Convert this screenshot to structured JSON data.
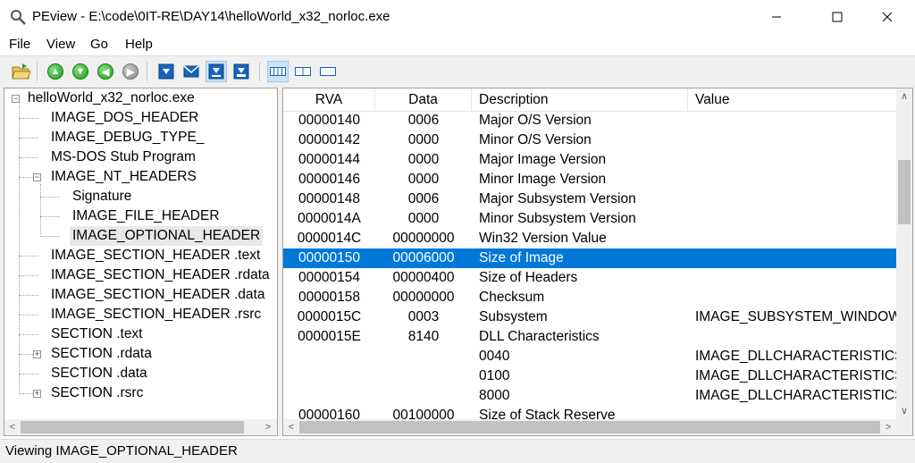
{
  "window": {
    "title": "PEview - E:\\code\\0IT-RE\\DAY14\\helloWorld_x32_norloc.exe",
    "minimize_glyph": "—",
    "maximize_glyph": "☐",
    "close_glyph": "✕"
  },
  "menu": [
    "File",
    "View",
    "Go",
    "Help"
  ],
  "toolbar": {
    "icons": [
      "open-folder-icon",
      "up-icon",
      "down-icon",
      "back-icon",
      "forward-icon",
      "save-icon",
      "mail-icon",
      "save-selected-icon",
      "export-icon",
      "view-byte-icon",
      "view-word-icon",
      "view-dword-icon"
    ]
  },
  "tree": {
    "items": [
      {
        "label": "helloWorld_x32_norloc.exe",
        "expander": "−"
      },
      {
        "label": "IMAGE_DOS_HEADER"
      },
      {
        "label": "IMAGE_DEBUG_TYPE_"
      },
      {
        "label": "MS-DOS Stub Program"
      },
      {
        "label": "IMAGE_NT_HEADERS",
        "expander": "−"
      },
      {
        "label": "Signature"
      },
      {
        "label": "IMAGE_FILE_HEADER"
      },
      {
        "label": "IMAGE_OPTIONAL_HEADER",
        "selected": true
      },
      {
        "label": "IMAGE_SECTION_HEADER .text"
      },
      {
        "label": "IMAGE_SECTION_HEADER .rdata"
      },
      {
        "label": "IMAGE_SECTION_HEADER .data"
      },
      {
        "label": "IMAGE_SECTION_HEADER .rsrc"
      },
      {
        "label": "SECTION .text"
      },
      {
        "label": "SECTION .rdata",
        "expander": "+"
      },
      {
        "label": "SECTION .data"
      },
      {
        "label": "SECTION .rsrc",
        "expander": "+"
      }
    ]
  },
  "table": {
    "columns": [
      "RVA",
      "Data",
      "Description",
      "Value"
    ],
    "rows": [
      [
        "00000140",
        "0006",
        "Major O/S Version",
        ""
      ],
      [
        "00000142",
        "0000",
        "Minor O/S Version",
        ""
      ],
      [
        "00000144",
        "0000",
        "Major Image Version",
        ""
      ],
      [
        "00000146",
        "0000",
        "Minor Image Version",
        ""
      ],
      [
        "00000148",
        "0006",
        "Major Subsystem Version",
        ""
      ],
      [
        "0000014A",
        "0000",
        "Minor Subsystem Version",
        ""
      ],
      [
        "0000014C",
        "00000000",
        "Win32 Version Value",
        ""
      ],
      [
        "00000150",
        "00006000",
        "Size of Image",
        ""
      ],
      [
        "00000154",
        "00000400",
        "Size of Headers",
        ""
      ],
      [
        "00000158",
        "00000000",
        "Checksum",
        ""
      ],
      [
        "0000015C",
        "0003",
        "Subsystem",
        "IMAGE_SUBSYSTEM_WINDOW"
      ],
      [
        "0000015E",
        "8140",
        "DLL Characteristics",
        ""
      ],
      [
        "",
        "",
        "0040",
        "IMAGE_DLLCHARACTERISTICS"
      ],
      [
        "",
        "",
        "0100",
        "IMAGE_DLLCHARACTERISTICS"
      ],
      [
        "",
        "",
        "8000",
        "IMAGE_DLLCHARACTERISTICS"
      ],
      [
        "00000160",
        "00100000",
        "Size of Stack Reserve",
        ""
      ]
    ],
    "selected_row": 7
  },
  "status": {
    "text": "Viewing IMAGE_OPTIONAL_HEADER"
  },
  "colors": {
    "selection": "#0078d7",
    "toolbar_green": "#1f9d1f",
    "toolbar_blue": "#1565c0"
  }
}
